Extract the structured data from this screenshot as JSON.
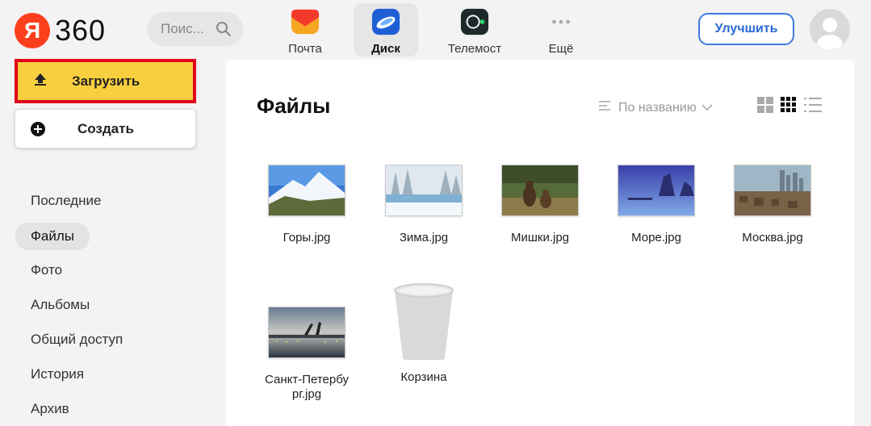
{
  "header": {
    "logo_letter": "Я",
    "logo_number": "360",
    "search_placeholder": "Поис...",
    "apps": [
      {
        "label": "Почта",
        "icon": "mail-icon"
      },
      {
        "label": "Диск",
        "icon": "disk-icon",
        "active": true
      },
      {
        "label": "Телемост",
        "icon": "telemost-icon"
      },
      {
        "label": "Ещё",
        "icon": "more-icon"
      }
    ],
    "upgrade_label": "Улучшить",
    "avatar_icon": "avatar-icon"
  },
  "sidebar": {
    "upload_label": "Загрузить",
    "create_label": "Создать",
    "items": [
      {
        "label": "Последние"
      },
      {
        "label": "Файлы",
        "active": true
      },
      {
        "label": "Фото"
      },
      {
        "label": "Альбомы"
      },
      {
        "label": "Общий доступ"
      },
      {
        "label": "История"
      },
      {
        "label": "Архив"
      }
    ]
  },
  "main": {
    "title": "Файлы",
    "sort_label": "По названию",
    "files": [
      {
        "name": "Горы.jpg",
        "thumb": "mountains"
      },
      {
        "name": "Зима.jpg",
        "thumb": "winter"
      },
      {
        "name": "Мишки.jpg",
        "thumb": "bears"
      },
      {
        "name": "Море.jpg",
        "thumb": "sea"
      },
      {
        "name": "Москва.jpg",
        "thumb": "moscow"
      },
      {
        "name": "Санкт-Петербург.jpg",
        "thumb": "spb"
      },
      {
        "name": "Корзина",
        "thumb": "trash"
      }
    ]
  },
  "colors": {
    "upload_bg": "#f8cf3e",
    "highlight_border": "#e0001b",
    "accent_blue": "#2a6ad8",
    "logo_red": "#fc3f1d"
  }
}
